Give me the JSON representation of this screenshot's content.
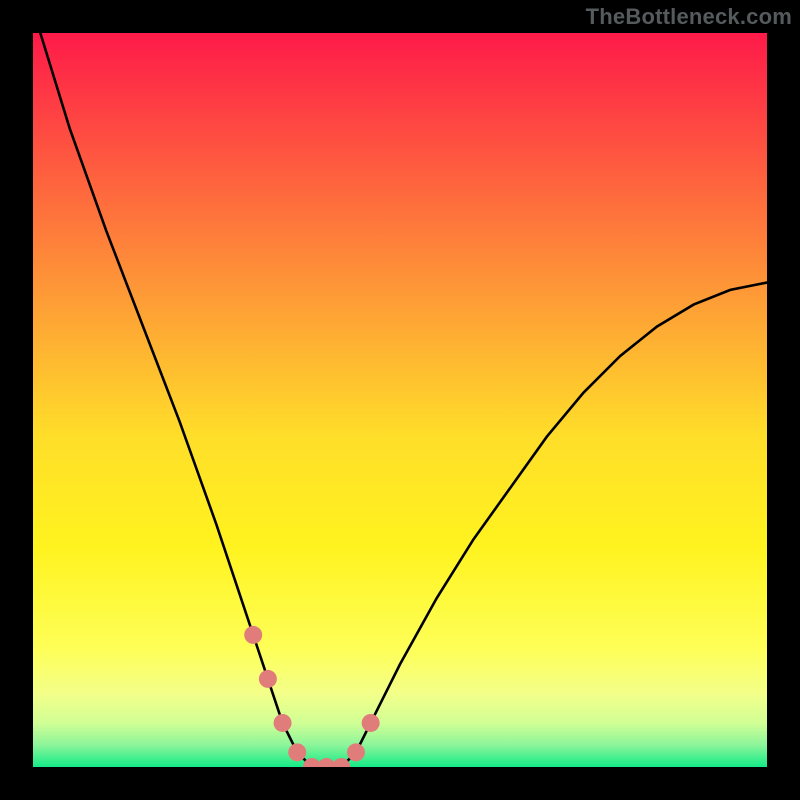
{
  "watermark": "TheBottleneck.com",
  "colors": {
    "top": "#fe1a49",
    "upper_mid": "#fe9837",
    "mid": "#fff31f",
    "lower_mid": "#ffff7e",
    "low": "#e3ff84",
    "bottom": "#14eb87",
    "curve": "#000000",
    "marker": "#e07d7a",
    "frame": "#000000"
  },
  "chart_data": {
    "type": "line",
    "title": "",
    "xlabel": "",
    "ylabel": "",
    "xlim": [
      0,
      100
    ],
    "ylim": [
      0,
      100
    ],
    "series": [
      {
        "name": "bottleneck-curve",
        "x": [
          1,
          5,
          10,
          15,
          20,
          25,
          28,
          30,
          32,
          34,
          36,
          38,
          40,
          42,
          44,
          46,
          50,
          55,
          60,
          65,
          70,
          75,
          80,
          85,
          90,
          95,
          100
        ],
        "values": [
          100,
          87,
          73,
          60,
          47,
          33,
          24,
          18,
          12,
          6,
          2,
          0,
          0,
          0,
          2,
          6,
          14,
          23,
          31,
          38,
          45,
          51,
          56,
          60,
          63,
          65,
          66
        ]
      }
    ],
    "markers": {
      "name": "highlight-points",
      "x": [
        30,
        32,
        34,
        36,
        38,
        40,
        42,
        44,
        46
      ],
      "values": [
        18,
        12,
        6,
        2,
        0,
        0,
        0,
        2,
        6
      ]
    }
  }
}
